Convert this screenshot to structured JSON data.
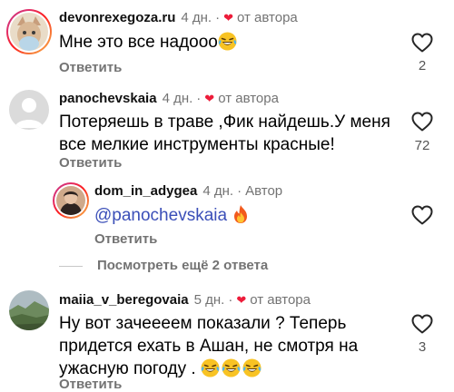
{
  "comments": [
    {
      "username": "devonrexegoza.ru",
      "time": "4 дн.",
      "badge": "от автора",
      "text": "Мне это все надооо",
      "reply": "Ответить",
      "likes": "2"
    },
    {
      "username": "panochevskaia",
      "time": "4 дн.",
      "badge": "от автора",
      "text_line1": "Потеряешь в траве ,Фик найдешь.У меня",
      "text_line2": "все мелкие инструменты красные!",
      "reply": "Ответить",
      "likes": "72"
    },
    {
      "username": "dom_in_adygea",
      "time": "4 дн.",
      "badge": "Автор",
      "mention": "@panochevskaia",
      "reply": "Ответить"
    },
    {
      "username": "maiia_v_beregovaia",
      "time": "5 дн.",
      "badge": "от автора",
      "text_line1": "Ну вот зачеееем показали ? Теперь",
      "text_line2": "придется ехать в Ашан, не смотря на",
      "text_line3": "ужасную погоду .",
      "reply": "Ответить",
      "likes": "3"
    }
  ],
  "view_more": "Посмотреть ещё 2 ответа",
  "separator_dot": "·",
  "colors": {
    "heart_red": "#ed1c3a",
    "meta_gray": "#737373",
    "mention_blue": "#3b4fb8"
  },
  "icons": [
    "heart-outline-icon",
    "heart-filled-icon",
    "laughing-emoji-icon",
    "fire-emoji-icon"
  ]
}
